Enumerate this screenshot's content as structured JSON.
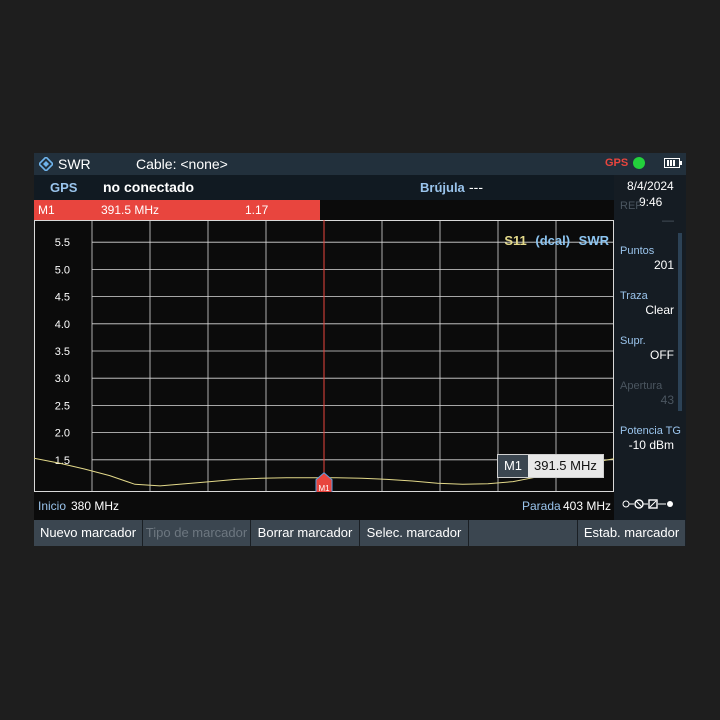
{
  "titlebar": {
    "mode": "SWR",
    "cable": "Cable: <none>",
    "gps_status_label": "GPS"
  },
  "gpsbar": {
    "gps_label": "GPS",
    "gps_value": "no conectado",
    "compass_label": "Brújula",
    "compass_value": "---"
  },
  "marker_table": {
    "name": "M1",
    "freq": "391.5 MHz",
    "value": "1.17"
  },
  "plot": {
    "trace_label_parts": [
      "S11",
      "(dcal)",
      "SWR"
    ],
    "marker_label": "M1",
    "marker_readout_name": "M1",
    "marker_readout_value": "391.5 MHz"
  },
  "freqbar": {
    "start_label": "Inicio",
    "start_value": "380 MHz",
    "stop_label": "Parada",
    "stop_value": "403 MHz"
  },
  "sidepanel": {
    "date": "8/4/2024",
    "time": "9:46",
    "items": [
      {
        "label": "REF",
        "value": "—",
        "disabled": true
      },
      {
        "label": "Puntos",
        "value": "201",
        "disabled": false
      },
      {
        "label": "Traza",
        "value": "Clear",
        "disabled": false
      },
      {
        "label": "Supr.",
        "value": "OFF",
        "disabled": false
      },
      {
        "label": "Apertura",
        "value": "43",
        "disabled": true
      },
      {
        "label": "Potencia TG",
        "value": "-10 dBm",
        "disabled": false
      }
    ]
  },
  "softkeys": [
    {
      "label": "Nuevo marcador",
      "disabled": false
    },
    {
      "label": "Tipo de marcador",
      "disabled": true
    },
    {
      "label": "Borrar marcador",
      "disabled": false
    },
    {
      "label": "Selec. marcador",
      "disabled": false
    },
    {
      "label": "",
      "disabled": false
    },
    {
      "label": "Estab. marcador",
      "disabled": false
    }
  ],
  "colors": {
    "accent_red": "#e8453e",
    "trace_yellow": "#e3d98a",
    "grid": "#d9d9d9",
    "label_blue": "#9ac4ec",
    "gps_green": "#23d13c"
  },
  "chart_data": {
    "type": "line",
    "x_unit": "MHz",
    "x_range": [
      380,
      403
    ],
    "ylim": [
      1.0,
      6.0
    ],
    "y_ticks": [
      "1.5",
      "2.0",
      "2.5",
      "3.0",
      "3.5",
      "4.0",
      "4.5",
      "5.0",
      "5.5"
    ],
    "grid": true,
    "series": [
      {
        "x": [
          380,
          381,
          382,
          383,
          384,
          385,
          386,
          387,
          388,
          389,
          390,
          391,
          391.5,
          392,
          393,
          394,
          395,
          396,
          397,
          398,
          399,
          400,
          401,
          402,
          403
        ],
        "y": [
          1.53,
          1.44,
          1.33,
          1.21,
          1.05,
          1.02,
          1.06,
          1.1,
          1.14,
          1.16,
          1.17,
          1.17,
          1.17,
          1.17,
          1.16,
          1.14,
          1.11,
          1.07,
          1.05,
          1.06,
          1.1,
          1.19,
          1.32,
          1.44,
          1.52
        ]
      }
    ],
    "marker": {
      "name": "M1",
      "x": 391.5,
      "y": 1.17
    }
  }
}
